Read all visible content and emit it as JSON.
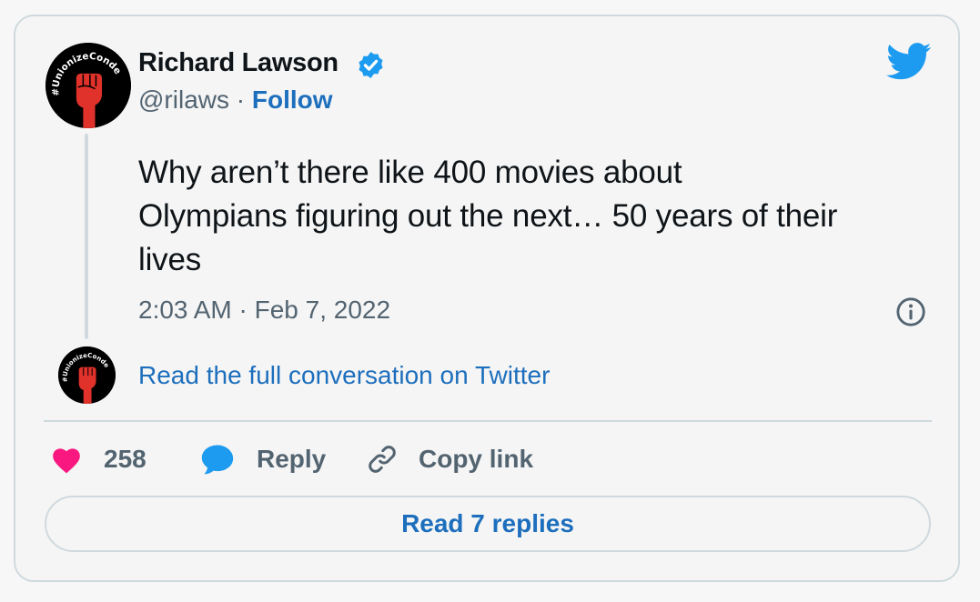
{
  "author": {
    "name": "Richard Lawson",
    "handle": "@rilaws",
    "separator": "·",
    "follow_label": "Follow",
    "verified": true,
    "avatar_text": "#UnionizeConde"
  },
  "tweet": {
    "text": "Why aren’t there like 400 movies about\nOlympians figuring out the next… 50 years of their\nlives",
    "timestamp": "2:03 AM · Feb 7, 2022"
  },
  "conversation": {
    "link_label": "Read the full conversation on Twitter"
  },
  "actions": {
    "like_count": "258",
    "reply_label": "Reply",
    "copy_label": "Copy link"
  },
  "replies_button": {
    "label": "Read 7 replies"
  },
  "icons": {
    "brand": "twitter-bird-icon",
    "verified": "verified-badge-icon",
    "info": "info-icon",
    "like": "heart-icon",
    "reply": "speech-bubble-icon",
    "copy": "link-icon"
  },
  "colors": {
    "brand_blue": "#1d9bf0",
    "link_blue": "#1d6fbd",
    "like_pink": "#f91880",
    "avatar_fist_red": "#e0322b",
    "text_secondary": "#536471",
    "border": "#cfd9de"
  }
}
